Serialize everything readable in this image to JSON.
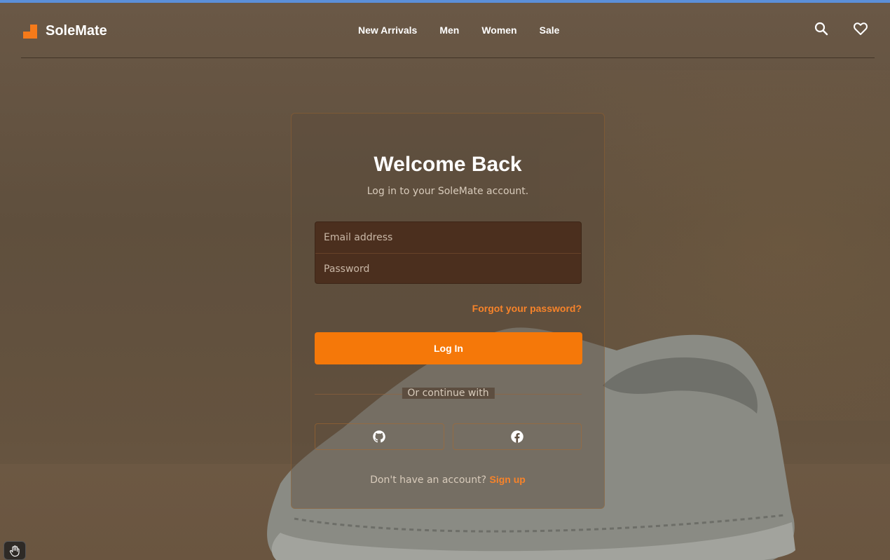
{
  "brand": {
    "name": "SoleMate",
    "accent": "#f57809"
  },
  "nav": [
    {
      "label": "New Arrivals"
    },
    {
      "label": "Men"
    },
    {
      "label": "Women"
    },
    {
      "label": "Sale"
    }
  ],
  "header_icons": [
    "search-icon",
    "heart-icon"
  ],
  "login": {
    "title": "Welcome Back",
    "subtitle": "Log in to your SoleMate account.",
    "email_placeholder": "Email address",
    "password_placeholder": "Password",
    "forgot": "Forgot your password?",
    "submit": "Log In",
    "divider": "Or continue with",
    "social": [
      "github-icon",
      "facebook-icon"
    ],
    "no_account": "Don't have an account?",
    "signup": "Sign up"
  },
  "floating_tool_icon": "hand-icon"
}
